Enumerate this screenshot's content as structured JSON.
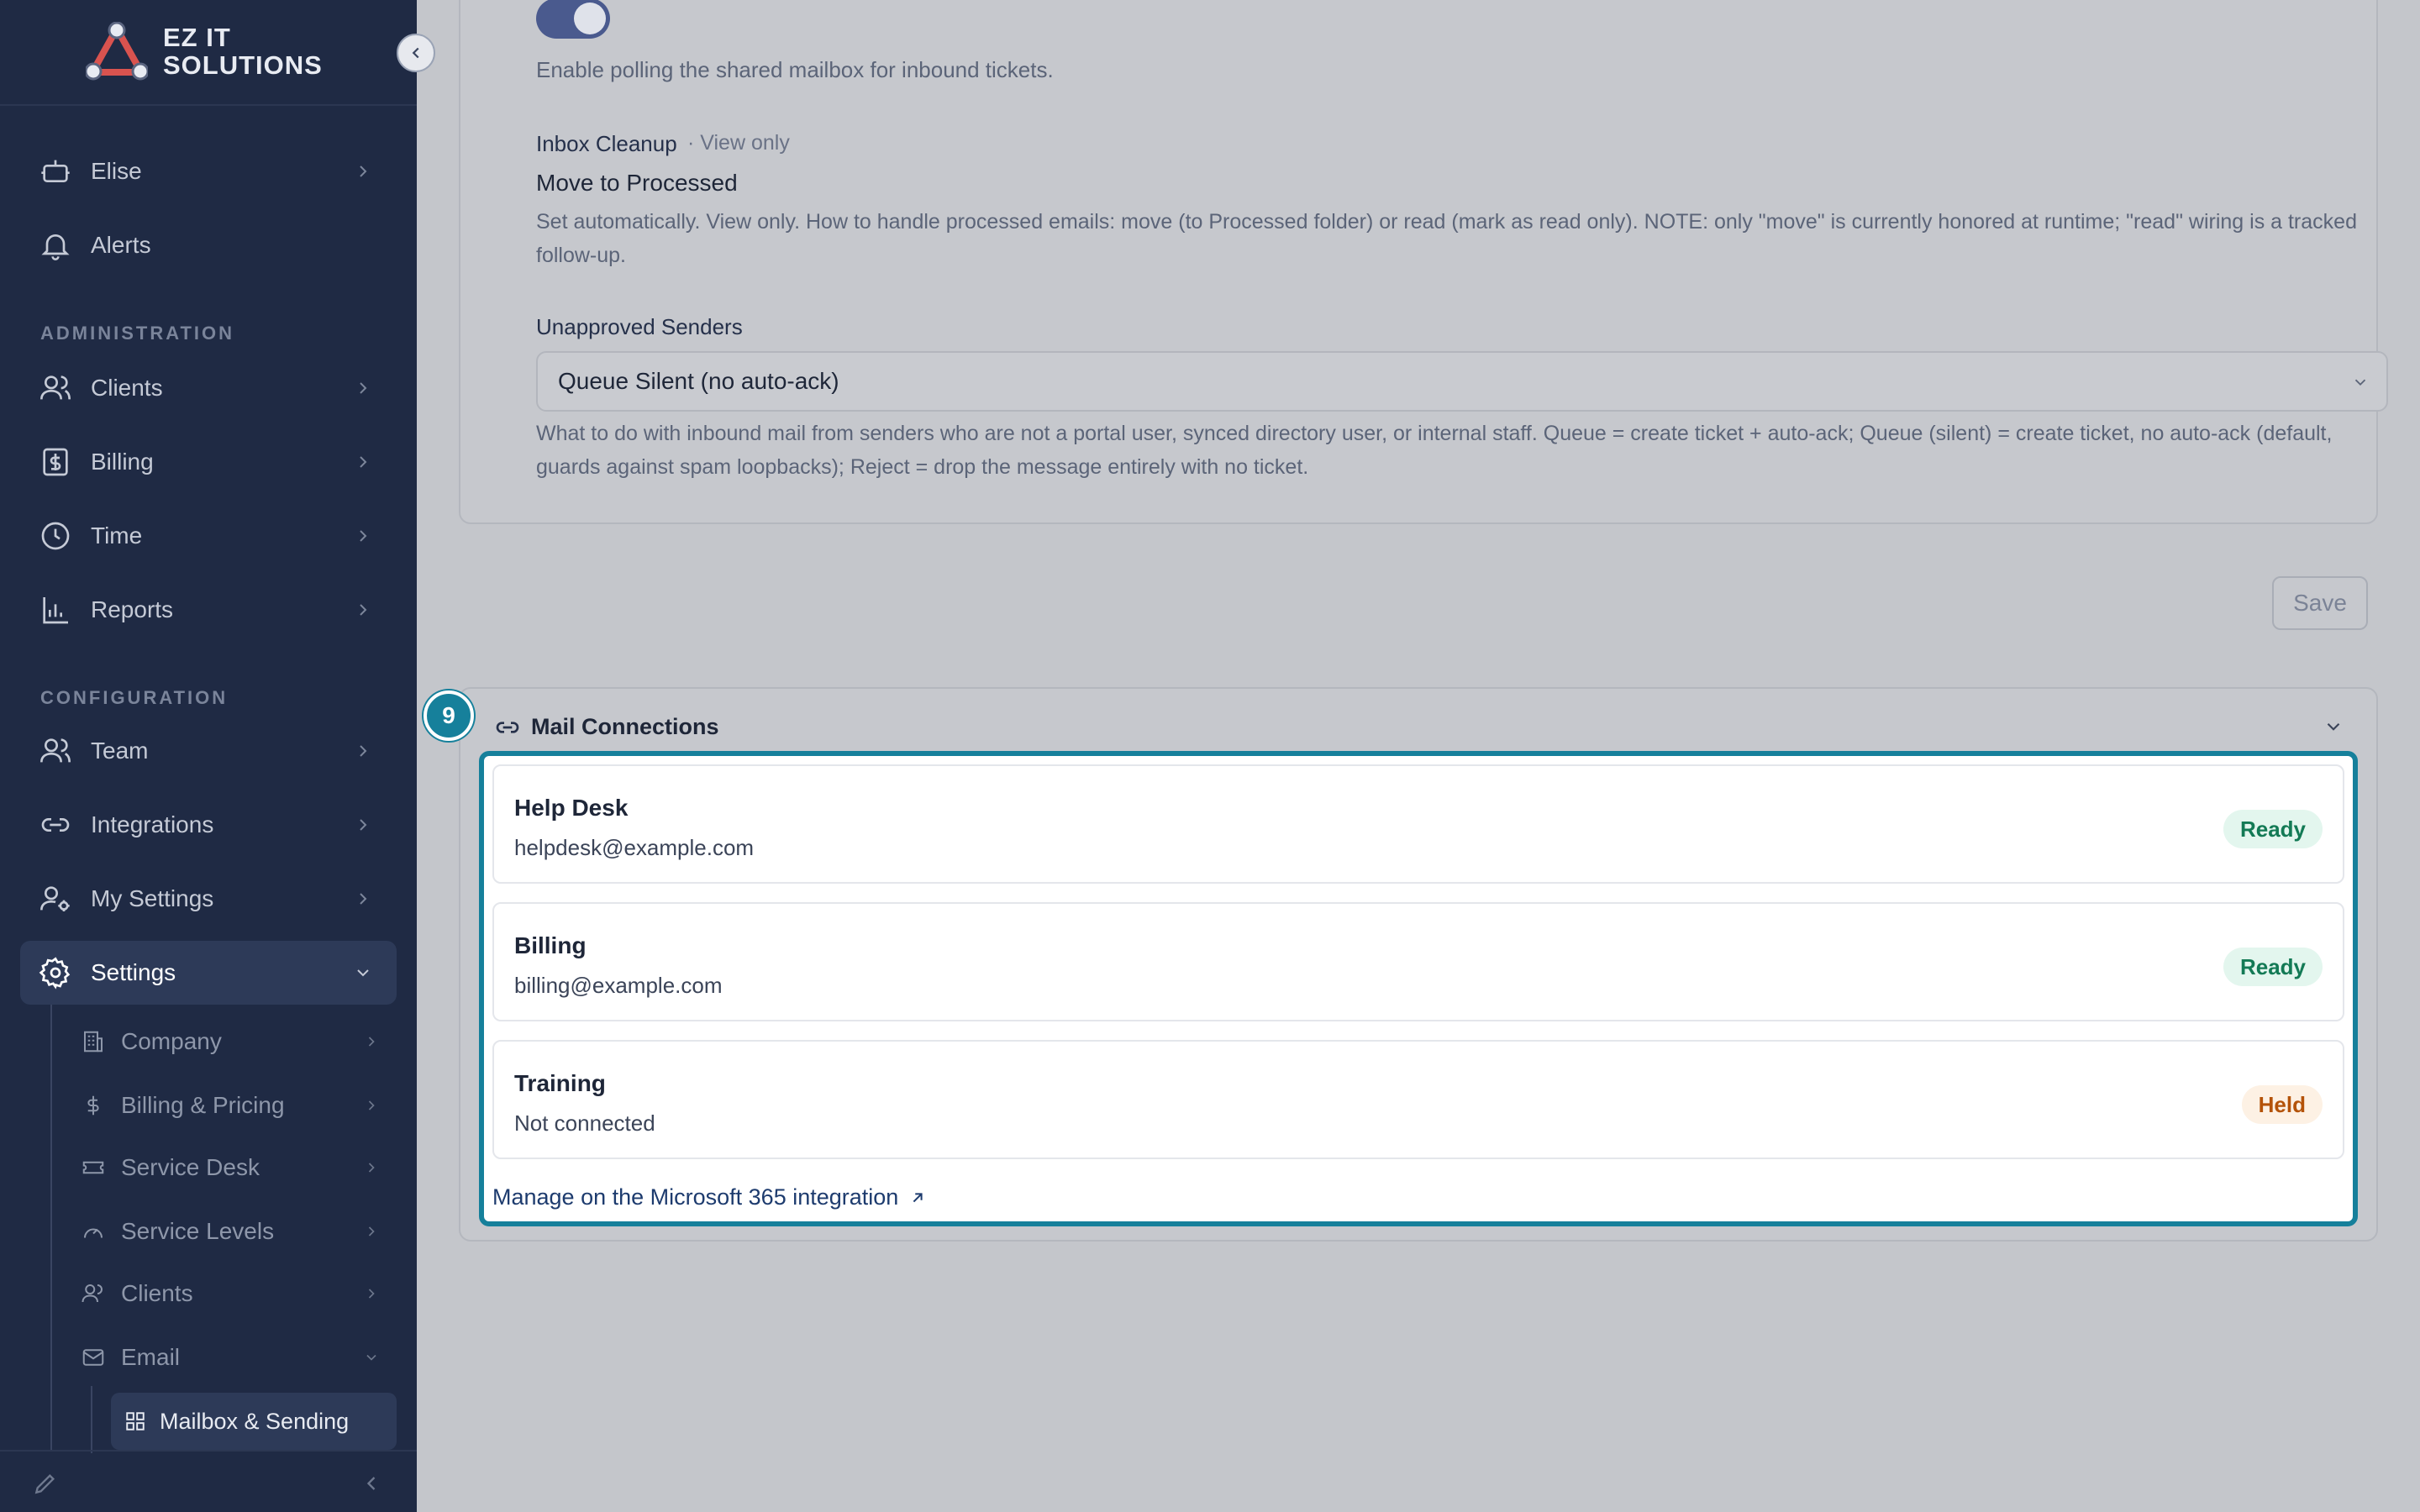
{
  "brand": {
    "name_line1": "EZ IT",
    "name_line2": "SOLUTIONS"
  },
  "sidebar": {
    "items_top": [
      {
        "label": "Elise",
        "icon": "robot-icon"
      },
      {
        "label": "Alerts",
        "icon": "bell-icon"
      }
    ],
    "section_admin": "ADMINISTRATION",
    "admin_items": [
      {
        "label": "Clients",
        "icon": "users-icon"
      },
      {
        "label": "Billing",
        "icon": "dollar-doc-icon"
      },
      {
        "label": "Time",
        "icon": "clock-icon"
      },
      {
        "label": "Reports",
        "icon": "bar-chart-icon"
      }
    ],
    "section_config": "CONFIGURATION",
    "config_items": [
      {
        "label": "Team",
        "icon": "users-icon"
      },
      {
        "label": "Integrations",
        "icon": "link-icon"
      },
      {
        "label": "My Settings",
        "icon": "user-gear-icon"
      },
      {
        "label": "Settings",
        "icon": "gear-icon"
      }
    ],
    "settings_sub": [
      {
        "label": "Company"
      },
      {
        "label": "Billing & Pricing"
      },
      {
        "label": "Service Desk"
      },
      {
        "label": "Service Levels"
      },
      {
        "label": "Clients"
      },
      {
        "label": "Email"
      }
    ],
    "email_sub": {
      "label": "Mailbox & Sending"
    }
  },
  "main": {
    "polling_toggle": {
      "on": true
    },
    "polling_desc": "Enable polling the shared mailbox for inbound tickets.",
    "inbox_cleanup": {
      "label": "Inbox Cleanup",
      "tag": "· View only",
      "value": "Move to Processed",
      "desc": "Set automatically. View only. How to handle processed emails: move (to Processed folder) or read (mark as read only). NOTE: only \"move\" is currently honored at runtime; \"read\" wiring is a tracked follow-up."
    },
    "unapproved": {
      "label": "Unapproved Senders",
      "selected": "Queue Silent (no auto-ack)",
      "desc": "What to do with inbound mail from senders who are not a portal user, synced directory user, or internal staff. Queue = create ticket + auto-ack; Queue (silent) = create ticket, no auto-ack (default, guards against spam loopbacks); Reject = drop the message entirely with no ticket."
    },
    "save_label": "Save",
    "step_number": "9",
    "mail_connections": {
      "title": "Mail Connections",
      "connections": [
        {
          "name": "Help Desk",
          "email": "helpdesk@example.com",
          "status": "Ready"
        },
        {
          "name": "Billing",
          "email": "billing@example.com",
          "status": "Ready"
        },
        {
          "name": "Training",
          "email": "Not connected",
          "status": "Held"
        }
      ],
      "manage_link": "Manage on the Microsoft 365 integration"
    }
  },
  "colors": {
    "sidebar": "#1f2a44",
    "accent": "#16809b",
    "ready": "#137a55",
    "held": "#b45309"
  }
}
